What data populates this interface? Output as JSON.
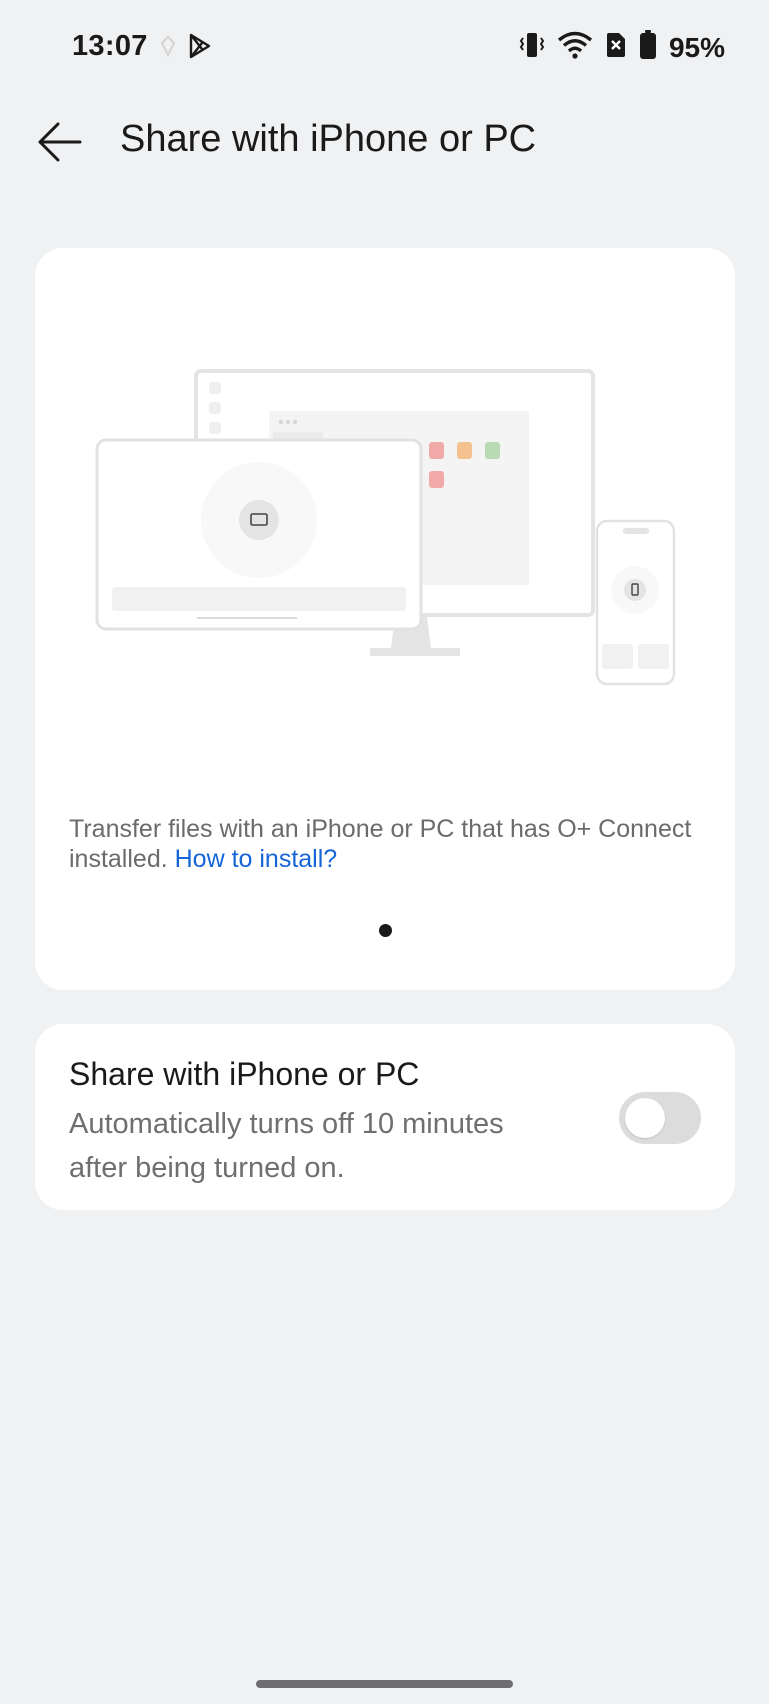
{
  "status_bar": {
    "time": "13:07",
    "battery": "95%",
    "icons": [
      "location-icon",
      "play-store-icon",
      "vibrate-icon",
      "wifi-icon",
      "no-sim-icon",
      "battery-icon"
    ]
  },
  "header": {
    "back_icon": "arrow-left-icon",
    "title": "Share with iPhone or PC"
  },
  "hero": {
    "description": "Transfer files with an iPhone or PC that has O+ Connect installed.",
    "link": "How to install?",
    "page_count": 1,
    "current_page": 1
  },
  "share_setting": {
    "title": "Share with iPhone or PC",
    "subtitle": "Automatically turns off 10 minutes after being turned on.",
    "enabled": false
  },
  "colors": {
    "background": "#f0f1f3",
    "card": "#ffffff",
    "link": "#1565d8",
    "toggle_off": "#dcdcdc"
  }
}
